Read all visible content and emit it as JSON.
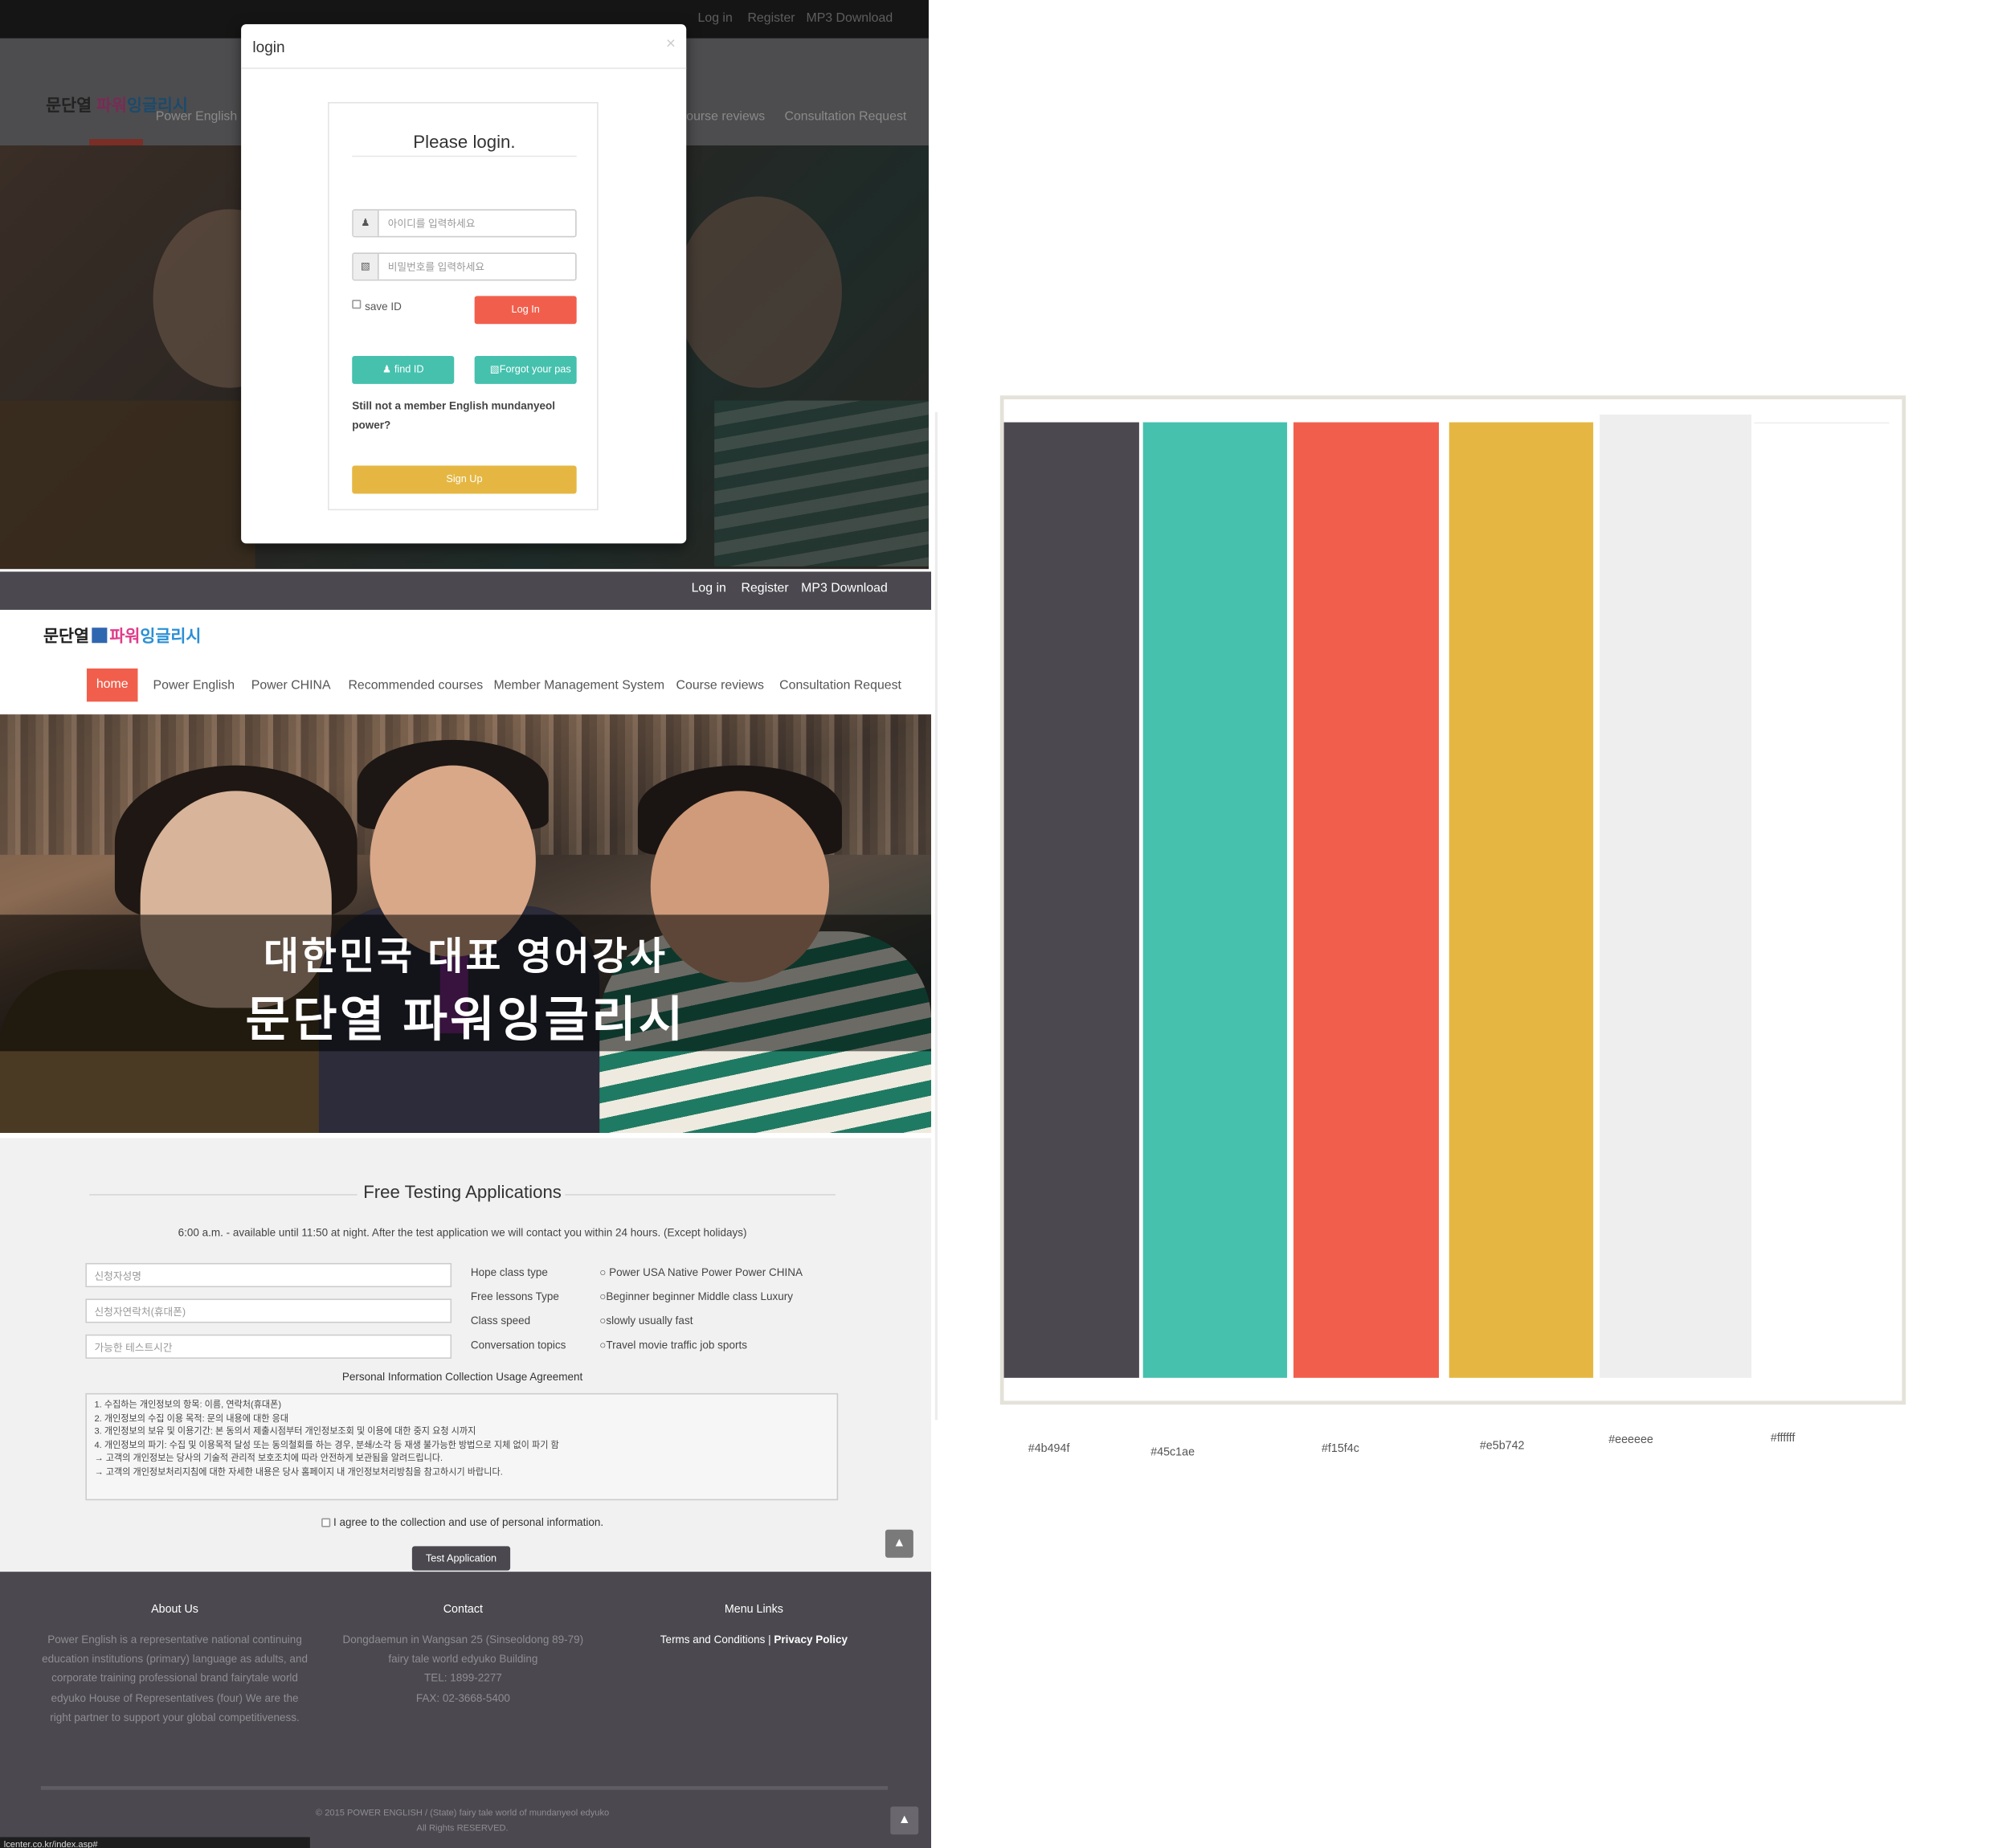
{
  "top_panel": {
    "topbar": {
      "login": "Log in",
      "register": "Register",
      "mp3": "MP3 Download"
    },
    "nav": {
      "home": "home",
      "power_english": "Power English",
      "course_reviews": "ourse reviews",
      "consultation": "Consultation Request"
    },
    "modal": {
      "title": "login",
      "close": "×",
      "heading": "Please login.",
      "id_placeholder": "아이디를 입력하세요",
      "pw_placeholder": "비밀번호를 입력하세요",
      "save_id": "save ID",
      "login_button": "Log In",
      "find_id_button": "find ID",
      "forgot_button": "Forgot your pas",
      "not_member": "Still not a member English mundanyeol power?",
      "signup_button": "Sign Up"
    }
  },
  "page": {
    "topbar": {
      "login": "Log in",
      "register": "Register",
      "mp3": "MP3 Download"
    },
    "logo": {
      "brand": "문단열",
      "kor_a": "파워",
      "kor_b": "잉글리시"
    },
    "nav": {
      "home": "home",
      "items": [
        "Power English",
        "Power CHINA",
        "Recommended courses",
        "Member Management System",
        "Course reviews",
        "Consultation Request"
      ]
    },
    "hero": {
      "line1": "대한민국 대표 영어강사",
      "line2": "문단열 파워잉글리시"
    },
    "form": {
      "title": "Free Testing Applications",
      "subtitle": "6:00 a.m. - available until 11:50 at night. After the test application we will contact you within 24 hours. (Except holidays)",
      "inputs": [
        "신청자성명",
        "신청자연락처(휴대폰)",
        "가능한 테스트시간"
      ],
      "labels": [
        "Hope class type",
        "Free lessons Type",
        "Class speed",
        "Conversation topics"
      ],
      "options": [
        "Power USA  Native Power  Power CHINA",
        "Beginner  beginner  Middle class  Luxury",
        "slowly  usually  fast",
        "Travel  movie  traffic  job  sports"
      ],
      "agreement_title": "Personal Information Collection Usage Agreement",
      "agreement_lines": [
        "1. 수집하는 개인정보의 항목: 이름, 연락처(휴대폰)",
        "2. 개인정보의 수집 이용 목적: 문의 내용에 대한 응대",
        "3. 개인정보의 보유 및 이용기간: 본 동의서 제출시점부터 개인정보조회 및 이용에 대한 중지 요청 시까지",
        "4. 개인정보의 파기: 수집 및 이용목적 달성 또는 동의철회를 하는 경우, 분쇄/소각 등 재생 불가능한 방법으로 지체 없이 파기 함",
        "→ 고객의 개인정보는 당사의 기술적 관리적 보호조치에 따라 안전하게 보관됨을 알려드립니다.",
        "→ 고객의 개인정보처리지침에 대한 자세한 내용은 당사 홈페이지 내 개인정보처리방침을 참고하시기 바랍니다."
      ],
      "agree_label": "I agree to the collection and use of personal information.",
      "submit": "Test Application"
    },
    "footer": {
      "about_title": "About Us",
      "about_text": "Power English is a representative national continuing education institutions (primary) language as adults, and corporate training professional brand fairytale world edyuko House of Representatives (four) We are the right partner to support your global competitiveness.",
      "contact_title": "Contact",
      "contact_lines": [
        "Dongdaemun in Wangsan 25 (Sinseoldong 89-79)",
        "fairy tale world edyuko Building",
        "TEL: 1899-2277",
        "FAX: 02-3668-5400"
      ],
      "menu_title": "Menu Links",
      "terms": "Terms and Conditions",
      "sep": "|",
      "privacy": "Privacy Policy",
      "copyright": "© 2015 POWER ENGLISH / (State) fairy tale world of mundanyeol edyuko",
      "rights": "All Rights RESERVED."
    },
    "status_url": "lcenter.co.kr/index.asp#"
  },
  "palette": {
    "colors": [
      {
        "hex": "#4b494f",
        "label": "#4b494f"
      },
      {
        "hex": "#45c1ae",
        "label": "#45c1ae"
      },
      {
        "hex": "#f15f4c",
        "label": "#f15f4c"
      },
      {
        "hex": "#e5b742",
        "label": "#e5b742"
      },
      {
        "hex": "#eeeeee",
        "label": "#eeeeee"
      },
      {
        "hex": "#ffffff",
        "label": "#ffffff"
      }
    ]
  },
  "icons": {
    "user": "user-icon",
    "lock": "lock-icon",
    "arrow_up": "arrow-up-icon"
  }
}
